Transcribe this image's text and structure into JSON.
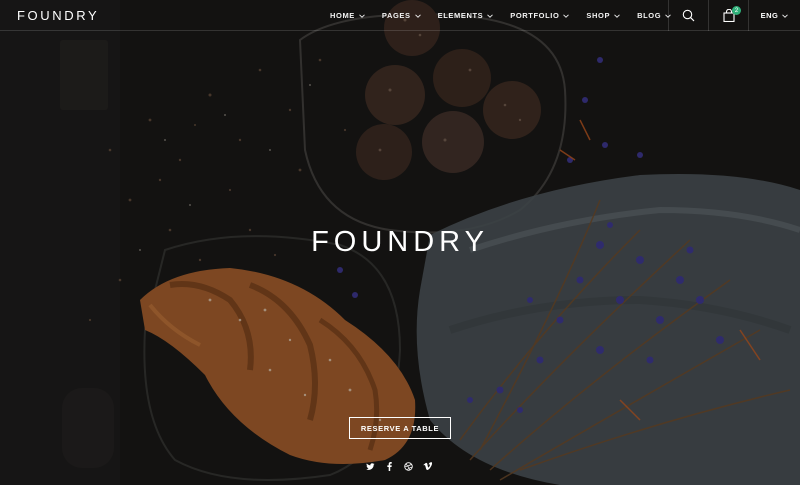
{
  "brand": {
    "logo_text": "FOUNDRY"
  },
  "nav": {
    "items": [
      {
        "label": "HOME"
      },
      {
        "label": "PAGES"
      },
      {
        "label": "ELEMENTS"
      },
      {
        "label": "PORTFOLIO"
      },
      {
        "label": "SHOP"
      },
      {
        "label": "BLOG"
      }
    ]
  },
  "header": {
    "cart_count": "2",
    "language": "ENG"
  },
  "hero": {
    "title": "FOUNDRY",
    "cta_label": "RESERVE A TABLE"
  },
  "social_icons": [
    "twitter-icon",
    "facebook-icon",
    "dribbble-icon",
    "vimeo-icon"
  ],
  "colors": {
    "accent": "#2fb17a",
    "text": "#ffffff",
    "background": "#141414"
  }
}
